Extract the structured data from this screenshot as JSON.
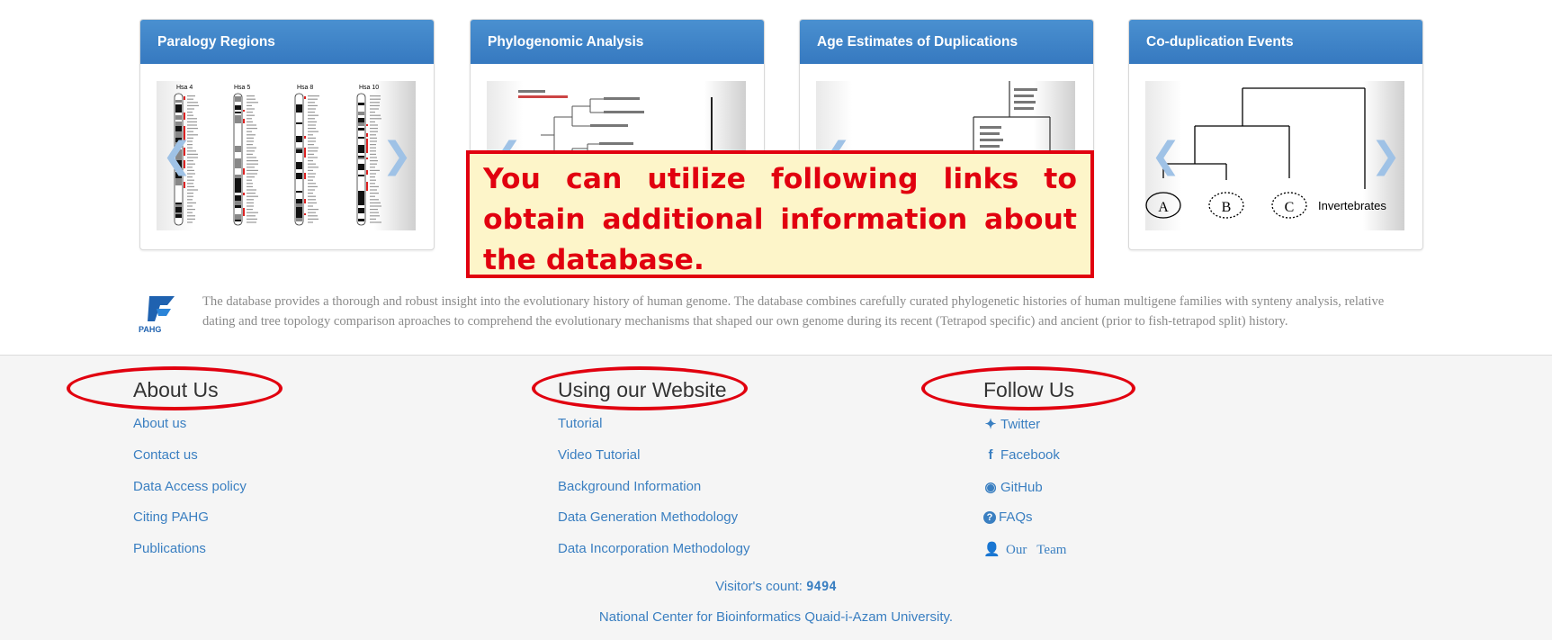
{
  "cards": [
    {
      "title": "Paralogy Regions",
      "image": "chromosome ideograms",
      "chrom_labels": [
        "Hsa 4",
        "Hsa 5",
        "Hsa 8",
        "Hsa 10"
      ]
    },
    {
      "title": "Phylogenomic Analysis",
      "image": "phylogenetic tree"
    },
    {
      "title": "Age Estimates of Duplications",
      "image": "dendrogram"
    },
    {
      "title": "Co-duplication Events",
      "image": "tree topology",
      "nodes": [
        "A",
        "B",
        "C"
      ],
      "outgroup": "Invertebrates"
    }
  ],
  "callout": {
    "text": "You can utilize following links to obtain additional information about the database."
  },
  "logo": {
    "text": "PAHG"
  },
  "description": "The database provides a thorough and robust insight into the evolutionary history of human genome. The database combines carefully curated phylogenetic histories of human multigene families with synteny analysis, relative dating and tree topology comparison aproaches to comprehend the evolutionary mechanisms that shaped our own genome during its recent (Tetrapod specific) and ancient (prior to fish-tetrapod split) history.",
  "footer": {
    "about": {
      "heading": "About Us",
      "links": [
        "About us",
        "Contact us",
        "Data Access policy",
        "Citing PAHG",
        "Publications"
      ]
    },
    "using": {
      "heading": "Using our Website",
      "links": [
        "Tutorial",
        "Video Tutorial",
        "Background Information",
        "Data Generation Methodology",
        "Data Incorporation Methodology"
      ]
    },
    "follow": {
      "heading": "Follow Us",
      "links": [
        {
          "label": "Twitter",
          "icon": "twitter-icon"
        },
        {
          "label": "Facebook",
          "icon": "facebook-icon"
        },
        {
          "label": "GitHub",
          "icon": "github-icon"
        },
        {
          "label": "FAQs",
          "icon": "question-circle-icon"
        },
        {
          "label": "Our   Team",
          "icon": "user-icon"
        }
      ]
    },
    "visitor_label": "Visitor's count:",
    "visitor_count": "9494",
    "institute": "National Center for Bioinformatics Quaid-i-Azam University."
  },
  "colors": {
    "card_header": "#3a82c8",
    "link": "#3a7fc1",
    "annotation": "#e1000f",
    "callout_bg": "#fdf5c9",
    "footer_bg": "#f5f5f5"
  }
}
